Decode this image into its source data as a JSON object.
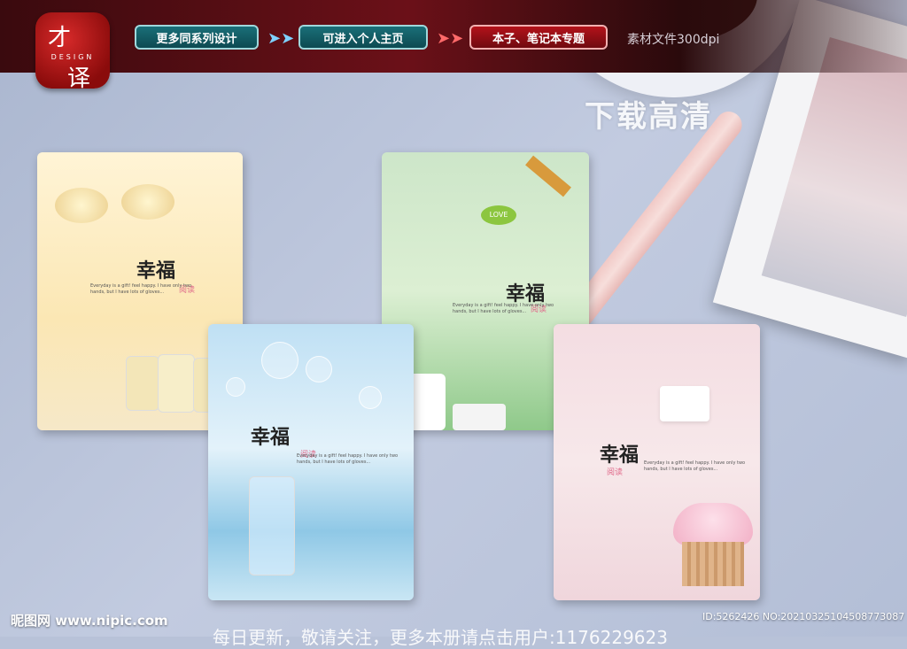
{
  "header": {
    "logo": {
      "char_top": "才",
      "word": "DESIGN",
      "char_bottom": "译"
    },
    "buttons": [
      "更多同系列设计",
      "可进入个人主页",
      "本子、笔记本专题"
    ],
    "resolution": "素材文件300dpi"
  },
  "overlay": {
    "hd_text": "下载高清"
  },
  "cards": [
    {
      "title": "幸福",
      "sub": "阅读",
      "tagline": "Everyday is a gift! feel happy. I have only two hands, but I have lots of gloves..."
    },
    {
      "title": "幸福",
      "sub": "阅读",
      "tagline": "Everyday is a gift! feel happy. I have only two hands, but I have lots of gloves..."
    },
    {
      "title": "幸福",
      "sub": "阅读",
      "tagline": "Everyday is a gift! feel happy. I have only two hands, but I have lots of gloves..."
    },
    {
      "title": "幸福",
      "sub": "阅读",
      "tagline": "Everyday is a gift! feel happy. I have only two hands, but I have lots of gloves..."
    }
  ],
  "green_card": {
    "love_badge": "LOVE"
  },
  "footer": {
    "site": "昵图网 www.nipic.com",
    "id": "ID:5262426 NO:20210325104508773087",
    "bottom": "每日更新，敬请关注，更多本册请点击用户:1176229623"
  },
  "colors": {
    "header_bg": "#5a0e14",
    "teal_button": "#136069",
    "red_button": "#a0101a"
  }
}
